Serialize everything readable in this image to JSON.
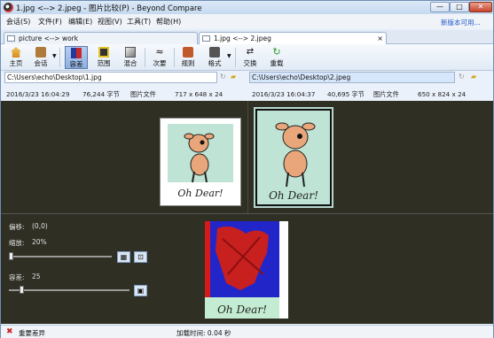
{
  "window": {
    "title": "1.jpg <--> 2.jpeg - 图片比较(P) - Beyond Compare",
    "min": "—",
    "max": "□",
    "close": "✕"
  },
  "menu": {
    "items": [
      "会话(S)",
      "文件(F)",
      "编辑(E)",
      "视图(V)",
      "工具(T)",
      "帮助(H)"
    ],
    "new_version": "新版本可用..."
  },
  "tabs": [
    {
      "label": "picture <--> work"
    },
    {
      "label": "1.jpg <--> 2.jpeg"
    }
  ],
  "toolbar": {
    "home": "主页",
    "session": "会话",
    "tolerance": "容差",
    "range": "范围",
    "blend": "混合",
    "next": "次要",
    "rules": "规则",
    "format": "格式",
    "swap": "交换",
    "reload": "重载"
  },
  "paths": {
    "left": "C:\\Users\\echo\\Desktop\\1.jpg",
    "right": "C:\\Users\\echo\\Desktop\\2.jpeg"
  },
  "info": {
    "left_date": "2016/3/23 16:04:29",
    "left_size": "76,244 字节",
    "left_type": "图片文件",
    "left_dim": "717 x 648 x 24",
    "right_date": "2016/3/23 16:04:37",
    "right_size": "40,695 字节",
    "right_type": "图片文件",
    "right_dim": "650 x 824 x 24"
  },
  "controls": {
    "offset_label": "偏移:",
    "offset_value": "(0,0)",
    "zoom_label": "缩放:",
    "zoom_value": "20%",
    "tolerance_label": "容差:",
    "tolerance_value": "25"
  },
  "images": {
    "caption": "Oh Dear!"
  },
  "status": {
    "text": "重要差异",
    "time": "加载时间: 0.04 秒"
  }
}
